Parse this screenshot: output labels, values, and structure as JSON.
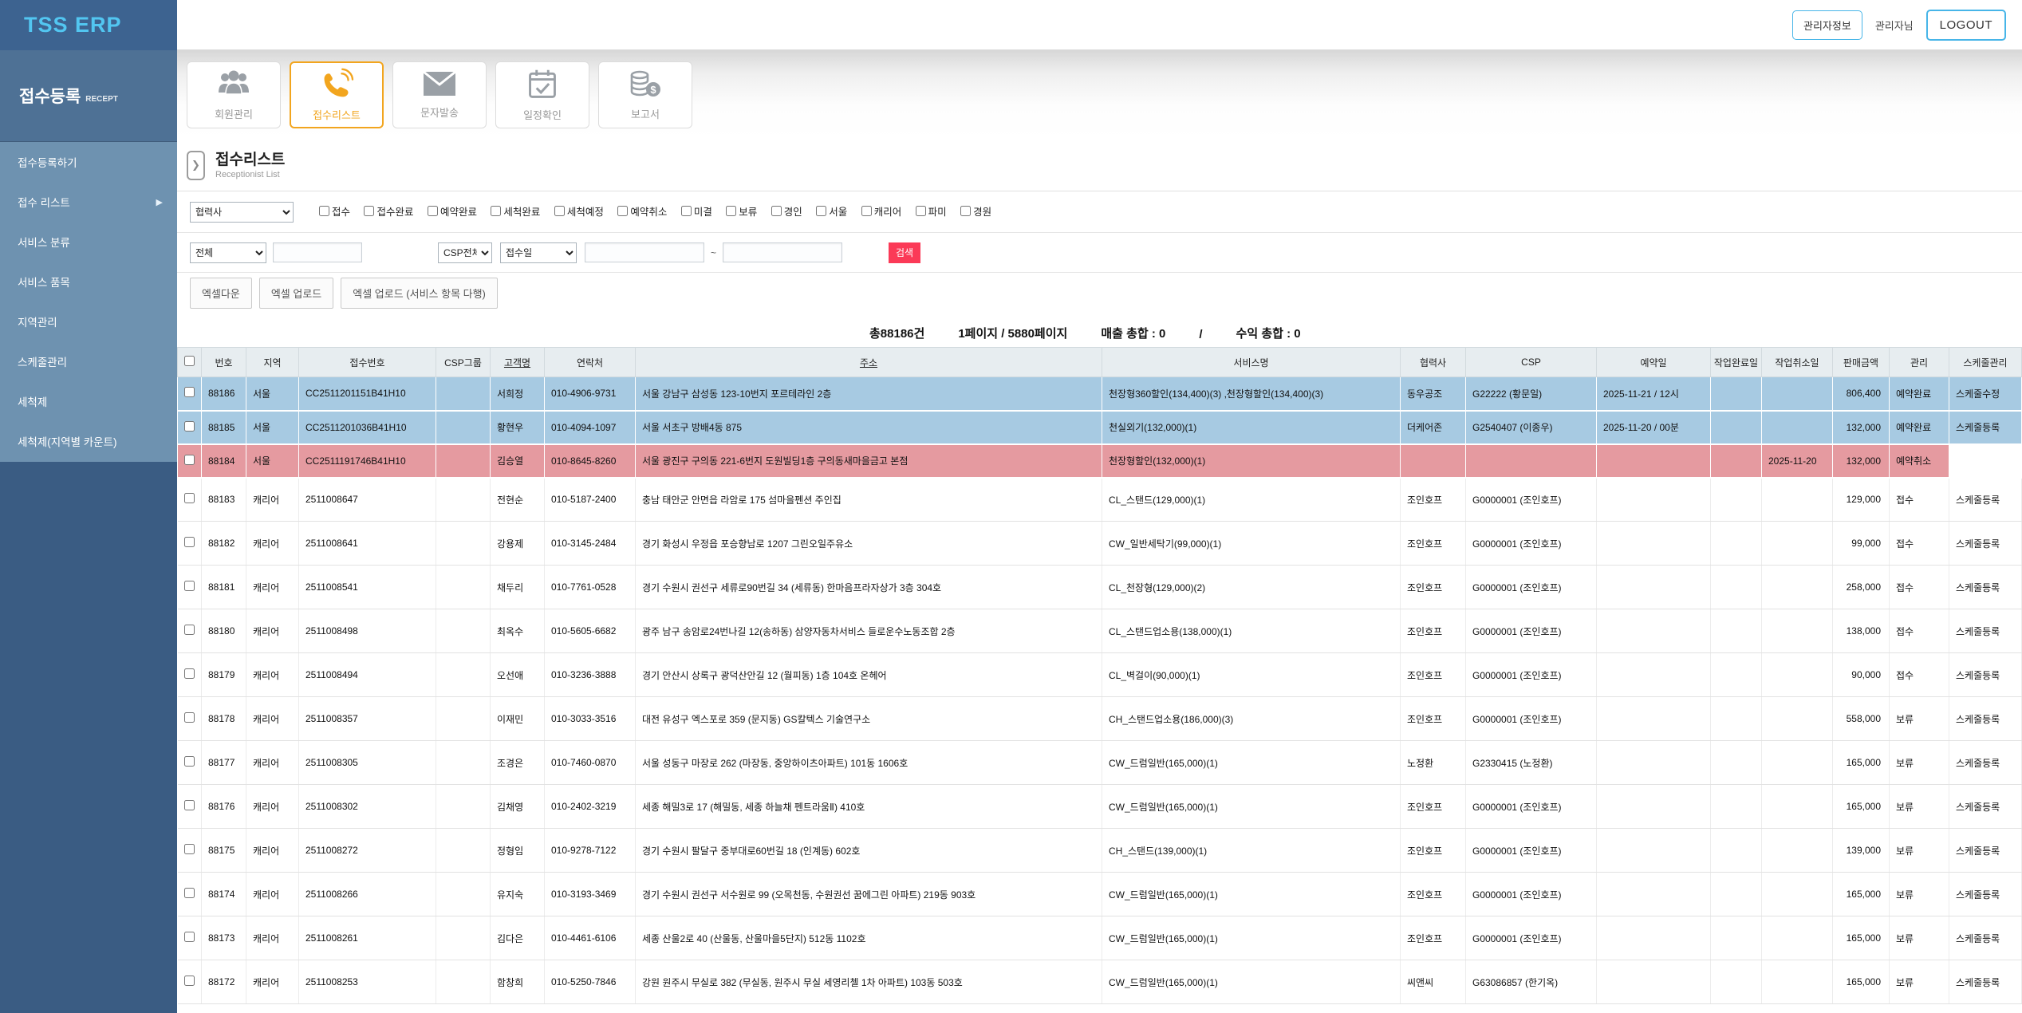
{
  "header": {
    "logo": "TSS ERP",
    "admin_info_button": "관리자정보",
    "admin_name": "관리자님",
    "logout_button": "LOGOUT"
  },
  "sidebar": {
    "section_title": "접수등록",
    "section_subtitle": "RECEPT",
    "items": [
      {
        "label": "접수등록하기"
      },
      {
        "label": "접수 리스트",
        "arrow": "▶"
      },
      {
        "label": "서비스 분류"
      },
      {
        "label": "서비스 품목"
      },
      {
        "label": "지역관리"
      },
      {
        "label": "스케줄관리"
      },
      {
        "label": "세척제"
      },
      {
        "label": "세척제(지역별 카운트)"
      }
    ]
  },
  "toolbar": {
    "items": [
      {
        "label": "회원관리"
      },
      {
        "label": "접수리스트"
      },
      {
        "label": "문자발송"
      },
      {
        "label": "일정확인"
      },
      {
        "label": "보고서"
      }
    ]
  },
  "page": {
    "title": "접수리스트",
    "subtitle": "Receptionist List"
  },
  "filters": {
    "partner_select": "협력사",
    "status_checkboxes": [
      "접수",
      "접수완료",
      "예약완료",
      "세척완료",
      "세척예정",
      "예약취소",
      "미결",
      "보류",
      "경인",
      "서울",
      "캐리어",
      "파미",
      "경원"
    ],
    "search_type_select": "전체",
    "search_input_value": "",
    "csp_select": "CSP전체",
    "date_type_select": "접수일",
    "date_from": "",
    "date_to": "",
    "tilde": "~",
    "search_button": "검색"
  },
  "actions": {
    "excel_download": "엑셀다운",
    "excel_upload": "엑셀 업로드",
    "excel_upload_multi": "엑셀 업로드 (서비스 항목 다행)"
  },
  "summary": {
    "total_count": "총88186건",
    "page_info": "1페이지 / 5880페이지",
    "sales_total": "매출 총합 : 0",
    "separator": "/",
    "profit_total": "수익 총합 : 0"
  },
  "table": {
    "columns": [
      {
        "label": "번호"
      },
      {
        "label": "지역"
      },
      {
        "label": "접수번호"
      },
      {
        "label": "CSP그룹"
      },
      {
        "label": "고객명",
        "u": "underline"
      },
      {
        "label": "연락처"
      },
      {
        "label": "주소",
        "u": "underline"
      },
      {
        "label": "서비스명"
      },
      {
        "label": "협력사"
      },
      {
        "label": "CSP"
      },
      {
        "label": "예약일"
      },
      {
        "label": "작업완료일"
      },
      {
        "label": "작업취소일"
      },
      {
        "label": "판매금액"
      },
      {
        "label": "관리"
      },
      {
        "label": "스케줄관리"
      }
    ],
    "rows": [
      {
        "no": "88186",
        "region": "서울",
        "receipt_no": "CC2511201151B41H10",
        "csp_group": "",
        "customer": "서희정",
        "phone": "010-4906-9731",
        "address": "서울 강남구 삼성동 123-10번지 포르테라인 2층",
        "service": "천장형360할인(134,400)(3) ,천장형할인(134,400)(3)",
        "partner": "동우공조",
        "csp": "G22222 (황문일)",
        "reserve_date": "2025-11-21 / 12시",
        "complete_date": "",
        "cancel_date": "",
        "amount": "806,400",
        "status": "예약완료",
        "schedule": "스케줄수정",
        "highlight": "blue"
      },
      {
        "no": "88185",
        "region": "서울",
        "receipt_no": "CC2511201036B41H10",
        "csp_group": "",
        "customer": "황현우",
        "phone": "010-4094-1097",
        "address": "서울 서초구 방배4동 875",
        "service": "천실외기(132,000)(1)",
        "partner": "더케어존",
        "csp": "G2540407 (이종우)",
        "reserve_date": "2025-11-20 / 00분",
        "complete_date": "",
        "cancel_date": "",
        "amount": "132,000",
        "status": "예약완료",
        "schedule": "스케줄등록",
        "highlight": "blue"
      },
      {
        "no": "88184",
        "region": "서울",
        "receipt_no": "CC2511191746B41H10",
        "csp_group": "",
        "customer": "김승열",
        "phone": "010-8645-8260",
        "address": "서울 광진구 구의동 221-6번지 도원빌딩1층 구의동새마을금고 본점",
        "service": "천장형할인(132,000)(1)",
        "partner": "",
        "csp": "",
        "reserve_date": "",
        "complete_date": "",
        "cancel_date": "2025-11-20",
        "amount": "132,000",
        "status": "예약취소",
        "schedule": "",
        "highlight": "pink"
      },
      {
        "no": "88183",
        "region": "캐리어",
        "receipt_no": "2511008647",
        "csp_group": "",
        "customer": "전현순",
        "phone": "010-5187-2400",
        "address": "충남 태안군 안면읍 라암로 175 섬마을펜션 주인집",
        "service": "CL_스탠드(129,000)(1)",
        "partner": "조인호프",
        "csp": "G0000001 (조인호프)",
        "reserve_date": "",
        "complete_date": "",
        "cancel_date": "",
        "amount": "129,000",
        "status": "접수",
        "schedule": "스케줄등록",
        "highlight": ""
      },
      {
        "no": "88182",
        "region": "캐리어",
        "receipt_no": "2511008641",
        "csp_group": "",
        "customer": "강용제",
        "phone": "010-3145-2484",
        "address": "경기 화성시 우정읍 포승향남로 1207 그린오일주유소",
        "service": "CW_일반세탁기(99,000)(1)",
        "partner": "조인호프",
        "csp": "G0000001 (조인호프)",
        "reserve_date": "",
        "complete_date": "",
        "cancel_date": "",
        "amount": "99,000",
        "status": "접수",
        "schedule": "스케줄등록",
        "highlight": ""
      },
      {
        "no": "88181",
        "region": "캐리어",
        "receipt_no": "2511008541",
        "csp_group": "",
        "customer": "채두리",
        "phone": "010-7761-0528",
        "address": "경기 수원시 권선구 세류로90번길 34 (세류동) 한마음프라자상가 3층 304호",
        "service": "CL_천장형(129,000)(2)",
        "partner": "조인호프",
        "csp": "G0000001 (조인호프)",
        "reserve_date": "",
        "complete_date": "",
        "cancel_date": "",
        "amount": "258,000",
        "status": "접수",
        "schedule": "스케줄등록",
        "highlight": ""
      },
      {
        "no": "88180",
        "region": "캐리어",
        "receipt_no": "2511008498",
        "csp_group": "",
        "customer": "최옥수",
        "phone": "010-5605-6682",
        "address": "광주 남구 송암로24번나길 12(송하동) 삼양자동차서비스 들로운수노동조합 2층",
        "service": "CL_스탠드업소용(138,000)(1)",
        "partner": "조인호프",
        "csp": "G0000001 (조인호프)",
        "reserve_date": "",
        "complete_date": "",
        "cancel_date": "",
        "amount": "138,000",
        "status": "접수",
        "schedule": "스케줄등록",
        "highlight": ""
      },
      {
        "no": "88179",
        "region": "캐리어",
        "receipt_no": "2511008494",
        "csp_group": "",
        "customer": "오선애",
        "phone": "010-3236-3888",
        "address": "경기 안산시 상록구 광덕산안길 12 (월피동) 1층 104호 온헤어",
        "service": "CL_벽걸이(90,000)(1)",
        "partner": "조인호프",
        "csp": "G0000001 (조인호프)",
        "reserve_date": "",
        "complete_date": "",
        "cancel_date": "",
        "amount": "90,000",
        "status": "접수",
        "schedule": "스케줄등록",
        "highlight": ""
      },
      {
        "no": "88178",
        "region": "캐리어",
        "receipt_no": "2511008357",
        "csp_group": "",
        "customer": "이재민",
        "phone": "010-3033-3516",
        "address": "대전 유성구 엑스포로 359 (문지동) GS칼텍스 기술연구소",
        "service": "CH_스탠드업소용(186,000)(3)",
        "partner": "조인호프",
        "csp": "G0000001 (조인호프)",
        "reserve_date": "",
        "complete_date": "",
        "cancel_date": "",
        "amount": "558,000",
        "status": "보류",
        "schedule": "스케줄등록",
        "highlight": ""
      },
      {
        "no": "88177",
        "region": "캐리어",
        "receipt_no": "2511008305",
        "csp_group": "",
        "customer": "조경은",
        "phone": "010-7460-0870",
        "address": "서울 성동구 마장로 262 (마장동, 중앙하이츠아파트) 101동 1606호",
        "service": "CW_드럼일반(165,000)(1)",
        "partner": "노정환",
        "csp": "G2330415 (노정환)",
        "reserve_date": "",
        "complete_date": "",
        "cancel_date": "",
        "amount": "165,000",
        "status": "보류",
        "schedule": "스케줄등록",
        "highlight": ""
      },
      {
        "no": "88176",
        "region": "캐리어",
        "receipt_no": "2511008302",
        "csp_group": "",
        "customer": "김채영",
        "phone": "010-2402-3219",
        "address": "세종 해밀3로 17 (해밀동, 세종 하늘채 펜트라움Ⅱ) 410호",
        "service": "CW_드럼일반(165,000)(1)",
        "partner": "조인호프",
        "csp": "G0000001 (조인호프)",
        "reserve_date": "",
        "complete_date": "",
        "cancel_date": "",
        "amount": "165,000",
        "status": "보류",
        "schedule": "스케줄등록",
        "highlight": ""
      },
      {
        "no": "88175",
        "region": "캐리어",
        "receipt_no": "2511008272",
        "csp_group": "",
        "customer": "정형임",
        "phone": "010-9278-7122",
        "address": "경기 수원시 팔달구 중부대로60번길 18 (인계동) 602호",
        "service": "CH_스탠드(139,000)(1)",
        "partner": "조인호프",
        "csp": "G0000001 (조인호프)",
        "reserve_date": "",
        "complete_date": "",
        "cancel_date": "",
        "amount": "139,000",
        "status": "보류",
        "schedule": "스케줄등록",
        "highlight": ""
      },
      {
        "no": "88174",
        "region": "캐리어",
        "receipt_no": "2511008266",
        "csp_group": "",
        "customer": "유지숙",
        "phone": "010-3193-3469",
        "address": "경기 수원시 권선구 서수원로 99 (오목천동, 수원권선 꿈에그린 아파트) 219동 903호",
        "service": "CW_드럼일반(165,000)(1)",
        "partner": "조인호프",
        "csp": "G0000001 (조인호프)",
        "reserve_date": "",
        "complete_date": "",
        "cancel_date": "",
        "amount": "165,000",
        "status": "보류",
        "schedule": "스케줄등록",
        "highlight": ""
      },
      {
        "no": "88173",
        "region": "캐리어",
        "receipt_no": "2511008261",
        "csp_group": "",
        "customer": "김다은",
        "phone": "010-4461-6106",
        "address": "세종 산울2로 40 (산울동, 산울마을5단지) 512동 1102호",
        "service": "CW_드럼일반(165,000)(1)",
        "partner": "조인호프",
        "csp": "G0000001 (조인호프)",
        "reserve_date": "",
        "complete_date": "",
        "cancel_date": "",
        "amount": "165,000",
        "status": "보류",
        "schedule": "스케줄등록",
        "highlight": ""
      },
      {
        "no": "88172",
        "region": "캐리어",
        "receipt_no": "2511008253",
        "csp_group": "",
        "customer": "함창희",
        "phone": "010-5250-7846",
        "address": "강원 원주시 무실로 382 (무실동, 원주시 무실 세영리첼 1차 아파트) 103동 503호",
        "service": "CW_드럼일반(165,000)(1)",
        "partner": "씨앤씨",
        "csp": "G63086857 (한기옥)",
        "reserve_date": "",
        "complete_date": "",
        "cancel_date": "",
        "amount": "165,000",
        "status": "보류",
        "schedule": "스케줄등록",
        "highlight": ""
      }
    ]
  }
}
